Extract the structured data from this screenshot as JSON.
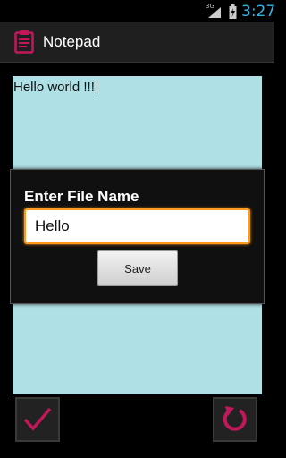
{
  "status_bar": {
    "network": "3G",
    "time": "3:27"
  },
  "action_bar": {
    "title": "Notepad",
    "icon": "clipboard-icon"
  },
  "editor": {
    "text": "Hello world !!!",
    "background": "#aee0e6"
  },
  "dialog": {
    "title": "Enter File Name",
    "input_value": "Hello",
    "save_label": "Save",
    "accent": "#ff9a1c"
  },
  "bottom_bar": {
    "left_icon": "checkmark-icon",
    "right_icon": "refresh-icon",
    "icon_color": "#c2185b"
  }
}
